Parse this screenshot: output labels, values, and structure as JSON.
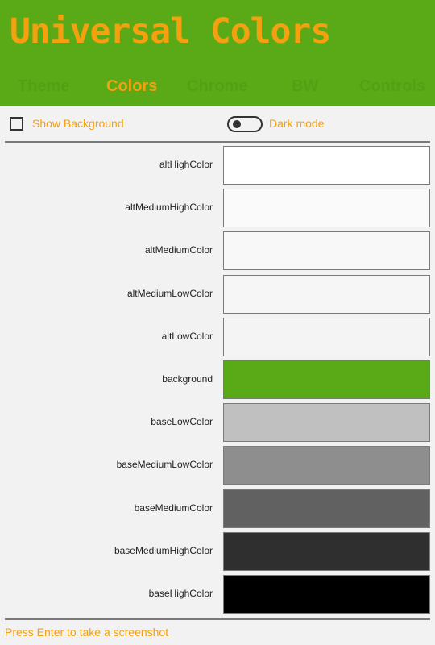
{
  "header": {
    "title": "Universal Colors",
    "tabs": [
      {
        "label": "Theme",
        "active": false
      },
      {
        "label": "Colors",
        "active": true
      },
      {
        "label": "Chrome",
        "active": false
      },
      {
        "label": "BW",
        "active": false
      },
      {
        "label": "Controls",
        "active": false
      }
    ]
  },
  "toolbar": {
    "show_background_label": "Show Background",
    "show_background_checked": false,
    "dark_mode_label": "Dark mode",
    "dark_mode_on": false
  },
  "colors": [
    {
      "name": "altHighColor",
      "hex": "#ffffff"
    },
    {
      "name": "altMediumHighColor",
      "hex": "#fafafa"
    },
    {
      "name": "altMediumColor",
      "hex": "#f8f8f8"
    },
    {
      "name": "altMediumLowColor",
      "hex": "#f6f6f6"
    },
    {
      "name": "altLowColor",
      "hex": "#f4f4f4"
    },
    {
      "name": "background",
      "hex": "#5aaa18"
    },
    {
      "name": "baseLowColor",
      "hex": "#c0c0c0"
    },
    {
      "name": "baseMediumLowColor",
      "hex": "#8e8e8e"
    },
    {
      "name": "baseMediumColor",
      "hex": "#616161"
    },
    {
      "name": "baseMediumHighColor",
      "hex": "#2f2f2f"
    },
    {
      "name": "baseHighColor",
      "hex": "#000000"
    }
  ],
  "footer": {
    "hint": "Press Enter to take a screenshot"
  },
  "theme": {
    "accent": "#f5a00f",
    "header_bg": "#5aaa18",
    "inactive_tab": "#54a015"
  }
}
